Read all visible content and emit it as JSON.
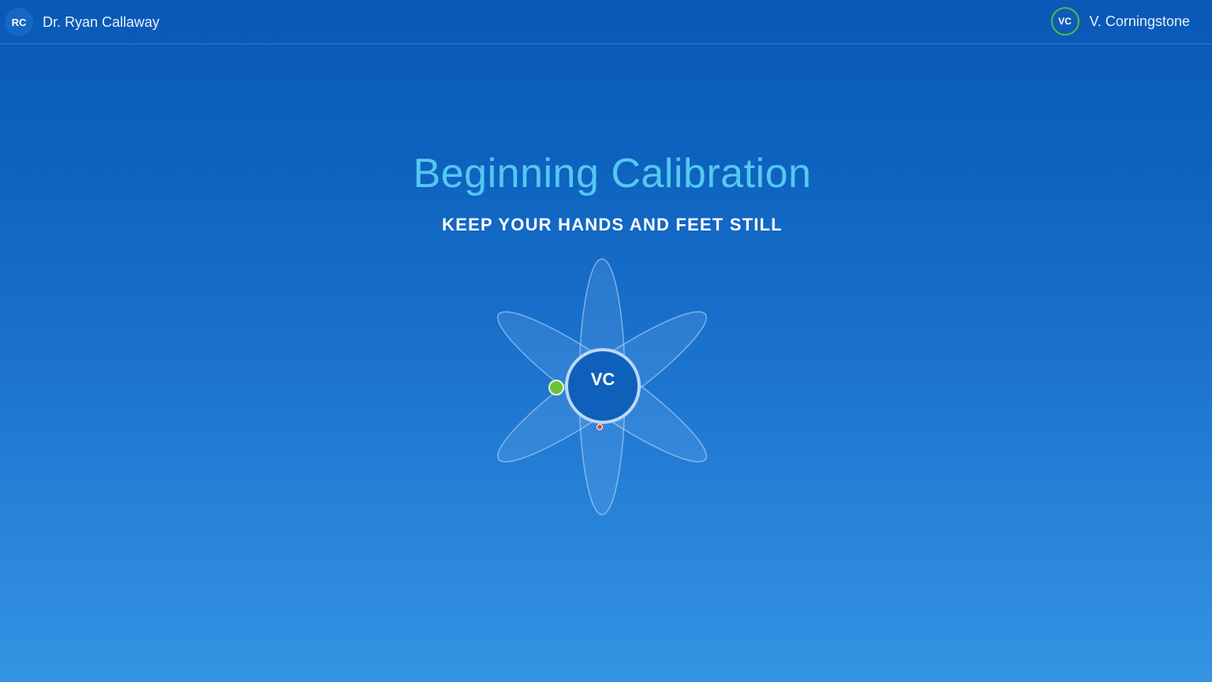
{
  "header": {
    "left_user": {
      "initials": "RC",
      "name": "Dr. Ryan Callaway"
    },
    "right_user": {
      "initials": "VC",
      "name": "V. Corningstone",
      "status_color": "#5bb843"
    }
  },
  "main": {
    "title": "Beginning Calibration",
    "instruction": "KEEP YOUR HANDS AND FEET STILL",
    "center_initials": "VC",
    "icon": "atom-orbit-icon",
    "marker_colors": {
      "green": "#6cc13a",
      "red": "#e04a4a"
    },
    "accent_color": "#54c8f2"
  }
}
